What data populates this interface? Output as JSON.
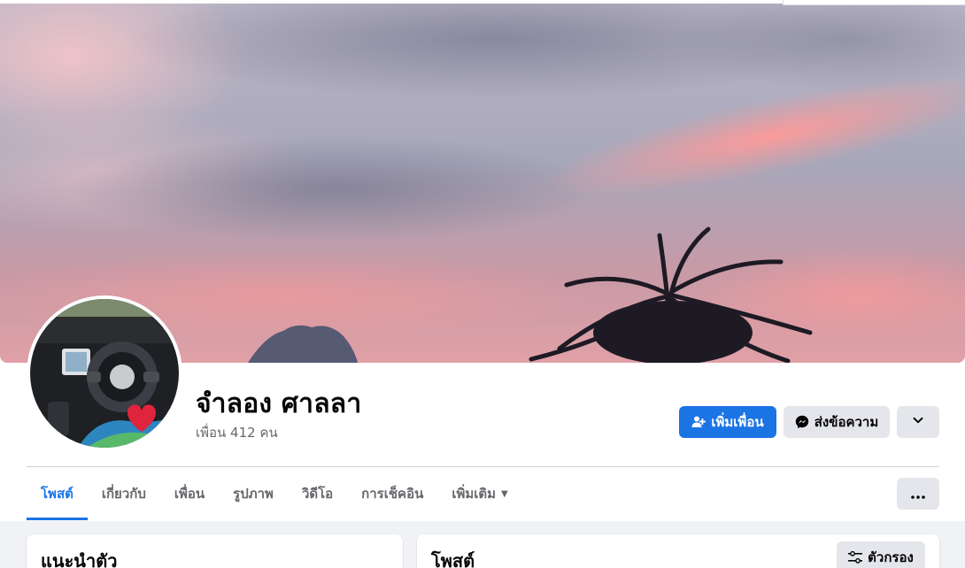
{
  "profile": {
    "name": "จำลอง ศาลลา",
    "friends_text": "เพื่อน 412 คน"
  },
  "actions": {
    "add_friend_label": "เพิ่มเพื่อน",
    "message_label": "ส่งข้อความ",
    "dropdown_icon": "chevron-down-icon"
  },
  "tabs": [
    {
      "label": "โพสต์",
      "active": true
    },
    {
      "label": "เกี่ยวกับ",
      "active": false
    },
    {
      "label": "เพื่อน",
      "active": false
    },
    {
      "label": "รูปภาพ",
      "active": false
    },
    {
      "label": "วิดีโอ",
      "active": false
    },
    {
      "label": "การเช็คอิน",
      "active": false
    },
    {
      "label": "เพิ่มเติม",
      "active": false
    }
  ],
  "intro_card": {
    "title": "แนะนำตัว"
  },
  "posts_card": {
    "title": "โพสต์",
    "filter_label": "ตัวกรอง"
  },
  "colors": {
    "accent": "#1b74e4",
    "secondary_button": "#e4e6eb",
    "muted_text": "#65676b",
    "page_background": "#f0f2f5"
  }
}
